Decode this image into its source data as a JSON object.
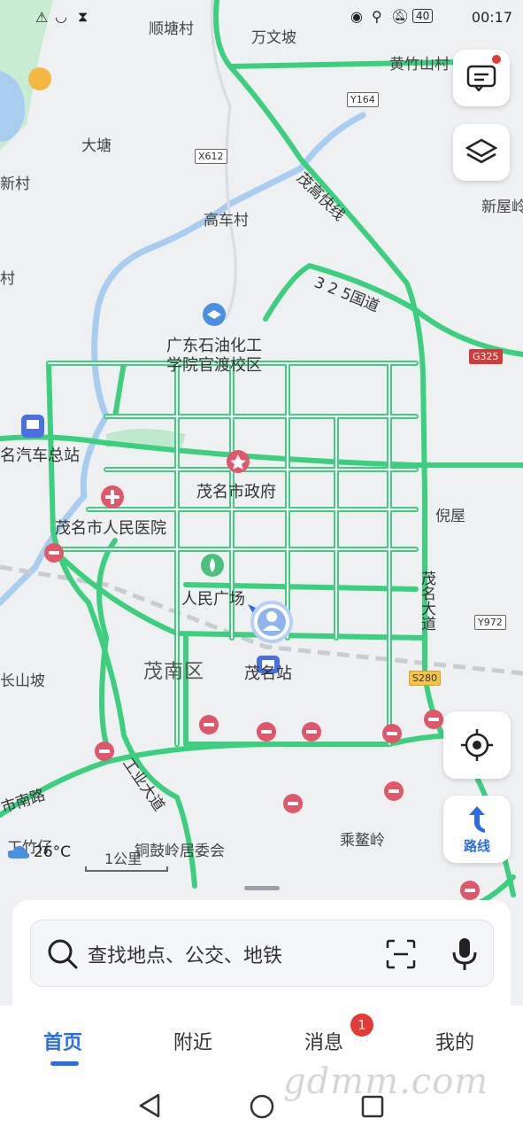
{
  "status_bar": {
    "time": "00:17",
    "battery": "40"
  },
  "map": {
    "places": [
      "顺塘村",
      "万文坡",
      "黄竹山村",
      "大塘",
      "新村",
      "高车村",
      "新屋岭",
      "村",
      "广东石油化工",
      "学院官渡校区",
      "名汽车总站",
      "茂名市政府",
      "茂名市人民医院",
      "倪屋",
      "人民广场",
      "茂名站",
      "长山坡",
      "乘鳌岭",
      "铜鼓岭居委会",
      "工竹仔"
    ],
    "district": "茂南区",
    "roads": {
      "expressway": "茂高快线",
      "national": "3 2 5国道",
      "avenue": "茂名大道",
      "industry": "工业大道",
      "city_south": "市南路"
    },
    "shields": [
      "Y164",
      "X612",
      "G325",
      "Y972",
      "S280"
    ],
    "road_color": "#3ccf7f",
    "water_color": "#a9cdf0",
    "park_color": "#bfe8cc"
  },
  "weather": {
    "temp": "26°C",
    "icon": "cloud-icon"
  },
  "scale": {
    "label": "1公里"
  },
  "controls": {
    "route_label": "路线"
  },
  "search": {
    "placeholder": "查找地点、公交、地铁"
  },
  "tabs": [
    {
      "label": "首页",
      "active": true
    },
    {
      "label": "附近",
      "active": false
    },
    {
      "label": "消息",
      "active": false,
      "badge": "1"
    },
    {
      "label": "我的",
      "active": false
    }
  ],
  "watermark": "gdmm.com",
  "colors": {
    "accent": "#2b6de3",
    "badge": "#e53935"
  }
}
